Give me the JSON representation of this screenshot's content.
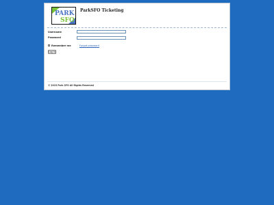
{
  "colors": {
    "background": "#1f6bc0",
    "panel": "#ffffff",
    "link": "#2a64b8",
    "logo_blue": "#4a73c4",
    "logo_green": "#7ac23a"
  },
  "header": {
    "logo_text_top": "PARK",
    "logo_text_bottom": "SFO",
    "title": "ParkSFO Ticketing"
  },
  "login": {
    "username_label": "Username",
    "username_value": "",
    "password_label": "Password",
    "password_value": "",
    "remember_checked": false,
    "remember_label": "Remember me",
    "forgot_link": "Forgot password",
    "login_button": "Log In"
  },
  "footer": {
    "copyright": "© 2019 Park SFO All Rights Reserved"
  }
}
